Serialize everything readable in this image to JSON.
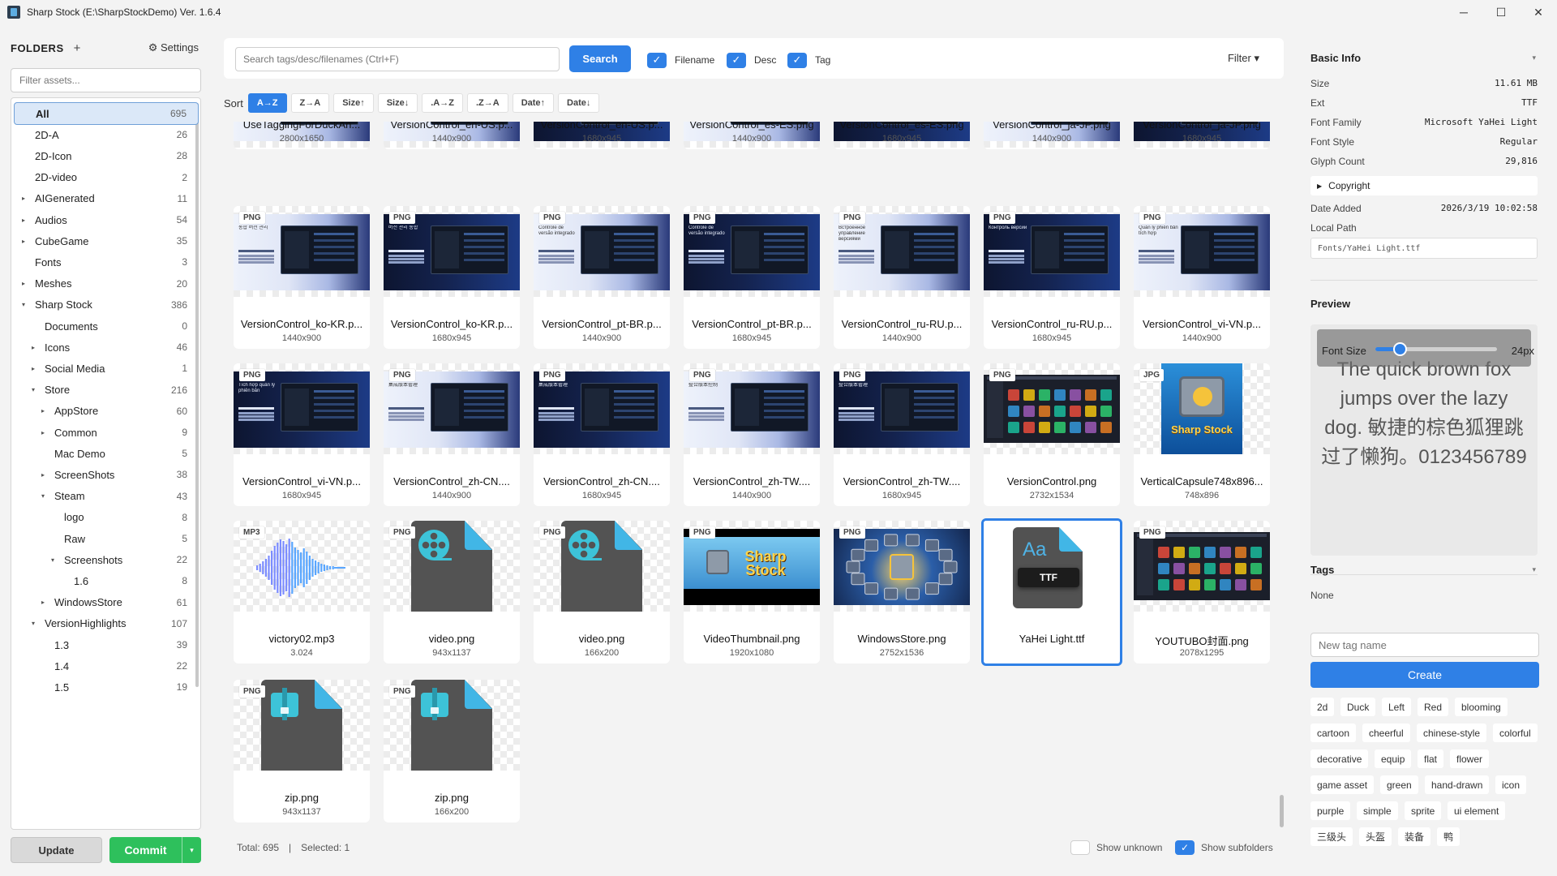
{
  "window": {
    "title": "Sharp Stock (E:\\SharpStockDemo) Ver. 1.6.4",
    "minimize": "─",
    "maximize": "☐",
    "close": "✕"
  },
  "sidebar": {
    "header": "FOLDERS",
    "add": "+",
    "settings": "⚙ Settings",
    "filter_placeholder": "Filter assets...",
    "tree": [
      {
        "label": "All",
        "count": "695",
        "level": 0,
        "expander": "",
        "selected": true
      },
      {
        "label": "2D-A",
        "count": "26",
        "level": 0,
        "expander": ""
      },
      {
        "label": "2D-Icon",
        "count": "28",
        "level": 0,
        "expander": ""
      },
      {
        "label": "2D-video",
        "count": "2",
        "level": 0,
        "expander": ""
      },
      {
        "label": "AIGenerated",
        "count": "11",
        "level": 0,
        "expander": "▸"
      },
      {
        "label": "Audios",
        "count": "54",
        "level": 0,
        "expander": "▸"
      },
      {
        "label": "CubeGame",
        "count": "35",
        "level": 0,
        "expander": "▸"
      },
      {
        "label": "Fonts",
        "count": "3",
        "level": 0,
        "expander": ""
      },
      {
        "label": "Meshes",
        "count": "20",
        "level": 0,
        "expander": "▸"
      },
      {
        "label": "Sharp Stock",
        "count": "386",
        "level": 0,
        "expander": "▾"
      },
      {
        "label": "Documents",
        "count": "0",
        "level": 1,
        "expander": ""
      },
      {
        "label": "Icons",
        "count": "46",
        "level": 1,
        "expander": "▸"
      },
      {
        "label": "Social Media",
        "count": "1",
        "level": 1,
        "expander": "▸"
      },
      {
        "label": "Store",
        "count": "216",
        "level": 1,
        "expander": "▾"
      },
      {
        "label": "AppStore",
        "count": "60",
        "level": 2,
        "expander": "▸"
      },
      {
        "label": "Common",
        "count": "9",
        "level": 2,
        "expander": "▸"
      },
      {
        "label": "Mac Demo",
        "count": "5",
        "level": 2,
        "expander": ""
      },
      {
        "label": "ScreenShots",
        "count": "38",
        "level": 2,
        "expander": "▸"
      },
      {
        "label": "Steam",
        "count": "43",
        "level": 2,
        "expander": "▾"
      },
      {
        "label": "logo",
        "count": "8",
        "level": 3,
        "expander": ""
      },
      {
        "label": "Raw",
        "count": "5",
        "level": 3,
        "expander": ""
      },
      {
        "label": "Screenshots",
        "count": "22",
        "level": 3,
        "expander": "▾"
      },
      {
        "label": "1.6",
        "count": "8",
        "level": 4,
        "expander": ""
      },
      {
        "label": "WindowsStore",
        "count": "61",
        "level": 2,
        "expander": "▸"
      },
      {
        "label": "VersionHighlights",
        "count": "107",
        "level": 1,
        "expander": "▾"
      },
      {
        "label": "1.3",
        "count": "39",
        "level": 2,
        "expander": ""
      },
      {
        "label": "1.4",
        "count": "22",
        "level": 2,
        "expander": ""
      },
      {
        "label": "1.5",
        "count": "19",
        "level": 2,
        "expander": ""
      }
    ],
    "update_label": "Update",
    "commit_label": "Commit",
    "commit_dropdown": "▾"
  },
  "toolbar": {
    "search_placeholder": "Search tags/desc/filenames (Ctrl+F)",
    "search_label": "Search",
    "checks": [
      {
        "label": "Filename",
        "checked": true
      },
      {
        "label": "Desc",
        "checked": true
      },
      {
        "label": "Tag",
        "checked": true
      }
    ],
    "check_mark": "✓",
    "filter_label": "Filter ▾"
  },
  "sort": {
    "label": "Sort",
    "options": [
      {
        "label": "A→Z",
        "active": true
      },
      {
        "label": "Z→A"
      },
      {
        "label": "Size↑"
      },
      {
        "label": "Size↓"
      },
      {
        "label": ".A→Z"
      },
      {
        "label": ".Z→A"
      },
      {
        "label": "Date↑"
      },
      {
        "label": "Date↓"
      }
    ]
  },
  "assets": [
    {
      "name": "UseTaggingForDuckAn...",
      "size": "2800x1650",
      "badge": "",
      "thumb": "top-light"
    },
    {
      "name": "VersionControl_en-US.p...",
      "size": "1440x900",
      "badge": "",
      "thumb": "top-light"
    },
    {
      "name": "VersionControl_en-US.p...",
      "size": "1680x945",
      "badge": "",
      "thumb": "top-dark"
    },
    {
      "name": "VersionControl_es-ES.png",
      "size": "1440x900",
      "badge": "",
      "thumb": "top-light"
    },
    {
      "name": "VersionControl_es-ES.png",
      "size": "1680x945",
      "badge": "",
      "thumb": "top-dark"
    },
    {
      "name": "VersionControl_ja-JP.png",
      "size": "1440x900",
      "badge": "",
      "thumb": "top-light"
    },
    {
      "name": "VersionControl_ja-JP.png",
      "size": "1680x945",
      "badge": "",
      "thumb": "top-dark"
    },
    {
      "name": "VersionControl_ko-KR.p...",
      "size": "1440x900",
      "badge": "PNG",
      "thumb": "vc-light",
      "caption": "통합 버전 관리"
    },
    {
      "name": "VersionControl_ko-KR.p...",
      "size": "1680x945",
      "badge": "PNG",
      "thumb": "vc-dark",
      "caption": "버전 관리 통합"
    },
    {
      "name": "VersionControl_pt-BR.p...",
      "size": "1440x900",
      "badge": "PNG",
      "thumb": "vc-light",
      "caption": "Controle de versão integrado"
    },
    {
      "name": "VersionControl_pt-BR.p...",
      "size": "1680x945",
      "badge": "PNG",
      "thumb": "vc-dark",
      "caption": "Controle de versão integrado"
    },
    {
      "name": "VersionControl_ru-RU.p...",
      "size": "1440x900",
      "badge": "PNG",
      "thumb": "vc-light",
      "caption": "Встроенное управление версиями"
    },
    {
      "name": "VersionControl_ru-RU.p...",
      "size": "1680x945",
      "badge": "PNG",
      "thumb": "vc-dark",
      "caption": "Контроль версий"
    },
    {
      "name": "VersionControl_vi-VN.p...",
      "size": "1440x900",
      "badge": "PNG",
      "thumb": "vc-light",
      "caption": "Quản lý phiên bản tích hợp"
    },
    {
      "name": "VersionControl_vi-VN.p...",
      "size": "1680x945",
      "badge": "PNG",
      "thumb": "vc-dark",
      "caption": "Tích hợp quản lý phiên bản"
    },
    {
      "name": "VersionControl_zh-CN....",
      "size": "1440x900",
      "badge": "PNG",
      "thumb": "vc-light",
      "caption": "集成版本管理"
    },
    {
      "name": "VersionControl_zh-CN....",
      "size": "1680x945",
      "badge": "PNG",
      "thumb": "vc-dark",
      "caption": "集成版本管理"
    },
    {
      "name": "VersionControl_zh-TW....",
      "size": "1440x900",
      "badge": "PNG",
      "thumb": "vc-light",
      "caption": "整合版本控制"
    },
    {
      "name": "VersionControl_zh-TW....",
      "size": "1680x945",
      "badge": "PNG",
      "thumb": "vc-dark",
      "caption": "整合版本管理"
    },
    {
      "name": "VersionControl.png",
      "size": "2732x1534",
      "badge": "PNG",
      "thumb": "app-dark"
    },
    {
      "name": "VerticalCapsule748x896...",
      "size": "748x896",
      "badge": "JPG",
      "thumb": "capsule",
      "caption": "Sharp Stock"
    },
    {
      "name": "victory02.mp3",
      "size": "3.024",
      "badge": "MP3",
      "thumb": "audio"
    },
    {
      "name": "video.png",
      "size": "943x1137",
      "badge": "PNG",
      "thumb": "video-doc"
    },
    {
      "name": "video.png",
      "size": "166x200",
      "badge": "PNG",
      "thumb": "video-doc"
    },
    {
      "name": "VideoThumbnail.png",
      "size": "1920x1080",
      "badge": "PNG",
      "thumb": "video-thumb",
      "caption": "Sharp Stock"
    },
    {
      "name": "WindowsStore.png",
      "size": "2752x1536",
      "badge": "PNG",
      "thumb": "store"
    },
    {
      "name": "YaHei Light.ttf",
      "size": "",
      "badge": "",
      "thumb": "ttf",
      "selected": true,
      "caption": "Aa",
      "ext": "TTF"
    },
    {
      "name": "YOUTUBO封面.png",
      "size": "2078x1295",
      "badge": "PNG",
      "thumb": "app-dark2"
    },
    {
      "name": "zip.png",
      "size": "943x1137",
      "badge": "PNG",
      "thumb": "zip-doc"
    },
    {
      "name": "zip.png",
      "size": "166x200",
      "badge": "PNG",
      "thumb": "zip-doc"
    }
  ],
  "info": {
    "basic_title": "Basic Info",
    "caret": "▾",
    "rows": [
      {
        "k": "Size",
        "v": "11.61 MB"
      },
      {
        "k": "Ext",
        "v": "TTF"
      },
      {
        "k": "Font Family",
        "v": "Microsoft YaHei Light"
      },
      {
        "k": "Font Style",
        "v": "Regular"
      },
      {
        "k": "Glyph Count",
        "v": "29,816"
      }
    ],
    "copyright": "Copyright",
    "date_added_label": "Date Added",
    "date_added": "2026/3/19 10:02:58",
    "local_path_label": "Local Path",
    "local_path": "Fonts/YaHei Light.ttf"
  },
  "preview": {
    "title": "Preview",
    "font_size_label": "Font Size",
    "font_size_value": "24px",
    "font_size_fraction": 0.2,
    "sample_text": "The quick brown fox jumps over the lazy dog. 敏捷的棕色狐狸跳过了懒狗。0123456789"
  },
  "tags_panel": {
    "title": "Tags",
    "current": "None",
    "new_placeholder": "New tag name",
    "create_label": "Create",
    "tags": [
      "2d",
      "Duck",
      "Left",
      "Red",
      "blooming",
      "cartoon",
      "cheerful",
      "chinese-style",
      "colorful",
      "decorative",
      "equip",
      "flat",
      "flower",
      "game asset",
      "green",
      "hand-drawn",
      "icon",
      "purple",
      "simple",
      "sprite",
      "ui element",
      "三级头",
      "头盔",
      "装备",
      "鸭"
    ]
  },
  "status": {
    "total": "Total: 695",
    "sep": "|",
    "selected": "Selected: 1",
    "show_unknown": "Show unknown",
    "show_subfolders": "Show subfolders",
    "show_unknown_checked": false,
    "show_subfolders_checked": true
  }
}
